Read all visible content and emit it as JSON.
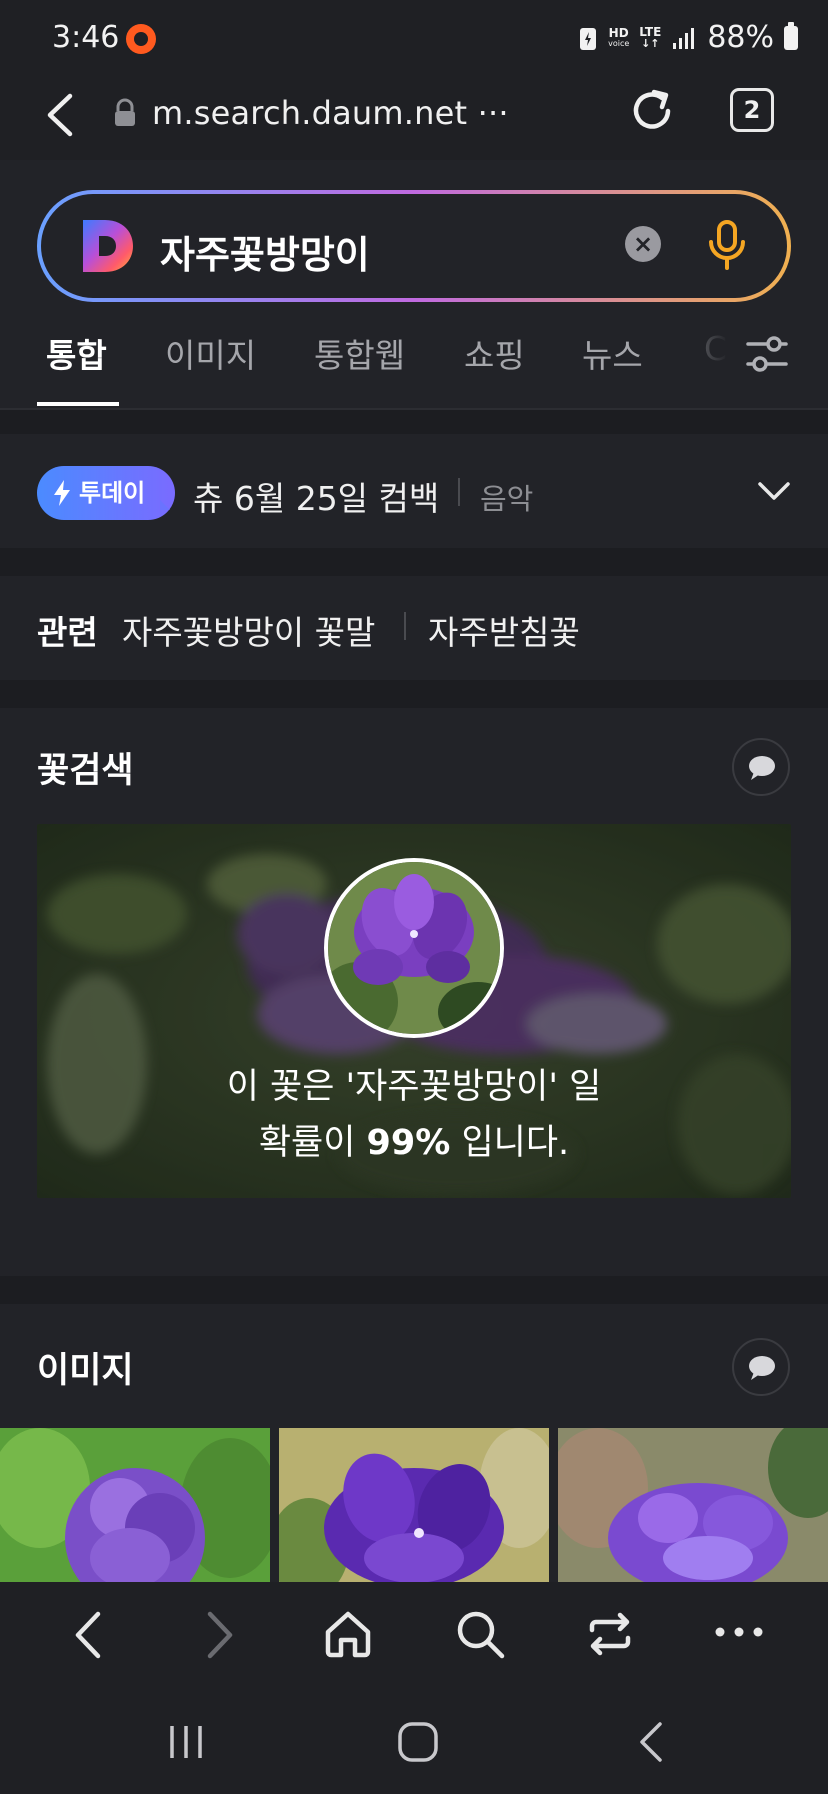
{
  "status_bar": {
    "time": "3:46",
    "network_hd": "HD",
    "network_voice": "voice",
    "network_lte": "LTE",
    "battery": "88%"
  },
  "url_bar": {
    "url": "m.search.daum.net ···",
    "tab_count": "2"
  },
  "search": {
    "query": "자주꽃방망이"
  },
  "tabs": [
    {
      "label": "통합"
    },
    {
      "label": "이미지"
    },
    {
      "label": "통합웹"
    },
    {
      "label": "쇼핑"
    },
    {
      "label": "뉴스"
    },
    {
      "label": "C"
    }
  ],
  "today": {
    "badge": "투데이",
    "text": "츄 6월 25일 컴백",
    "category": "음악"
  },
  "related": {
    "label": "관련",
    "items": [
      "자주꽃방망이 꽃말",
      "자주받침꽃"
    ]
  },
  "flower_search": {
    "title": "꽃검색",
    "line1": "이 꽃은 '자주꽃방망이' 일",
    "line2_prefix": "확률이 ",
    "line2_percent": "99%",
    "line2_suffix": " 입니다."
  },
  "images_section": {
    "title": "이미지"
  },
  "colors": {
    "background": "#1c1d21",
    "card": "#222328",
    "accent_gradient_start": "#6aa0ff",
    "accent_gradient_end": "#f0b050",
    "today_badge": "#5a7dff"
  }
}
